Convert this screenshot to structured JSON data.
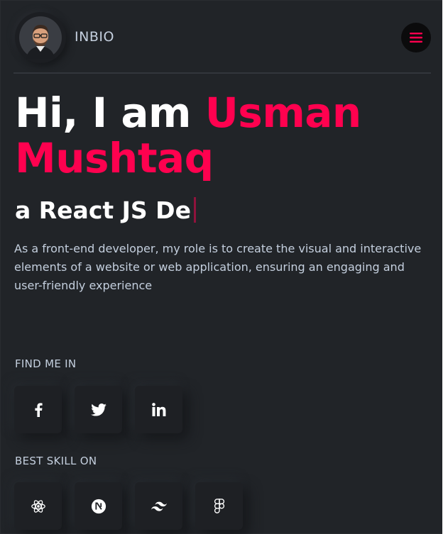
{
  "header": {
    "brand": "INBIO",
    "avatar_icon": "profile-photo",
    "menu_icon": "hamburger-menu-icon"
  },
  "hero": {
    "greeting": "Hi, I am",
    "first_name": "Usman",
    "last_name": "Mushtaq",
    "role_typed": "a React JS De",
    "description": "As a front-end developer, my role is to create the visual and interactive elements of a website or web application, ensuring an engaging and user-friendly experience"
  },
  "find_me": {
    "label": "FIND ME IN",
    "links": [
      {
        "icon": "facebook-icon"
      },
      {
        "icon": "twitter-icon"
      },
      {
        "icon": "linkedin-icon"
      }
    ]
  },
  "skills": {
    "label": "BEST SKILL ON",
    "items": [
      {
        "icon": "react-icon"
      },
      {
        "icon": "nextjs-icon"
      },
      {
        "icon": "tailwind-icon"
      },
      {
        "icon": "figma-icon"
      }
    ]
  },
  "colors": {
    "background": "#212428",
    "accent": "#ff014f",
    "text_body": "#c4cfde",
    "heading": "#ffffff"
  }
}
